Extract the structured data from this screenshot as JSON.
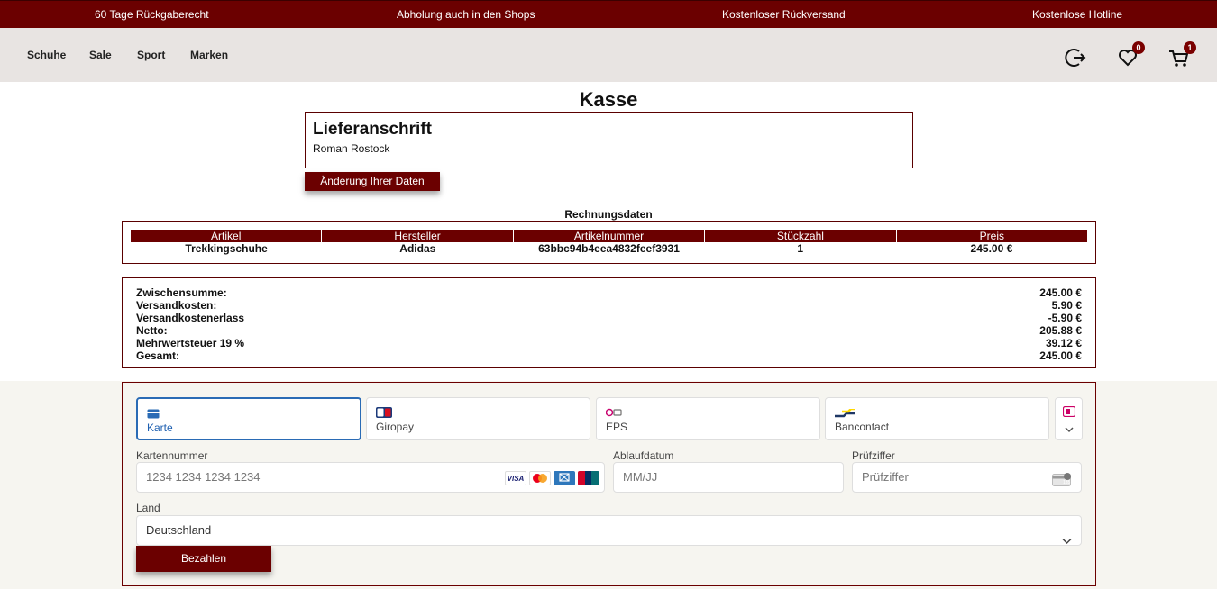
{
  "topbar": {
    "items": [
      "60 Tage Rückgaberecht",
      "Abholung auch in den Shops",
      "Kostenloser Rückversand",
      "Kostenlose Hotline"
    ]
  },
  "nav": {
    "links": [
      "Schuhe",
      "Sale",
      "Sport",
      "Marken"
    ],
    "icons": [
      "logout-icon",
      "heart-icon",
      "cart-icon"
    ],
    "wishlist_count": "0",
    "cart_count": "1"
  },
  "page": {
    "title": "Kasse"
  },
  "address": {
    "heading": "Lieferanschrift",
    "name": "Roman Rostock",
    "change_button": "Änderung Ihrer Daten"
  },
  "invoice": {
    "title": "Rechnungsdaten",
    "columns": [
      "Artikel",
      "Hersteller",
      "Artikelnummer",
      "Stückzahl",
      "Preis"
    ],
    "rows": [
      [
        "Trekkingschuhe",
        "Adidas",
        "63bbc94b4eea4832feef3931",
        "1",
        "245.00 €"
      ]
    ]
  },
  "totals": [
    {
      "label": "Zwischensumme:",
      "value": "245.00 €"
    },
    {
      "label": "Versandkosten:",
      "value": "5.90 €"
    },
    {
      "label": "Versandkostenerlass",
      "value": "-5.90 €"
    },
    {
      "label": "Netto:",
      "value": "205.88 €"
    },
    {
      "label": "Mehrwertsteuer 19 %",
      "value": "39.12 €"
    },
    {
      "label": "Gesamt:",
      "value": "245.00 €"
    }
  ],
  "payment": {
    "methods": [
      {
        "label": "Karte",
        "icon": "card-icon",
        "active": true
      },
      {
        "label": "Giropay",
        "icon": "giropay-icon",
        "active": false
      },
      {
        "label": "EPS",
        "icon": "eps-icon",
        "active": false
      },
      {
        "label": "Bancontact",
        "icon": "bancontact-icon",
        "active": false
      }
    ],
    "card_number_label": "Kartennummer",
    "card_number_placeholder": "1234 1234 1234 1234",
    "card_brands": [
      "VISA",
      "MC",
      "AMEX",
      "UnionPay"
    ],
    "expiry_label": "Ablaufdatum",
    "expiry_placeholder": "MM/JJ",
    "cvc_label": "Prüfziffer",
    "cvc_placeholder": "Prüfziffer",
    "cvc_badge": "135",
    "country_label": "Land",
    "country_value": "Deutschland",
    "pay_button": "Bezahlen"
  },
  "colors": {
    "brand": "#6b0000",
    "nav_bg": "#e8e4e2",
    "active_tab": "#2a6bb5",
    "payment_bg": "#f6f5f0"
  }
}
